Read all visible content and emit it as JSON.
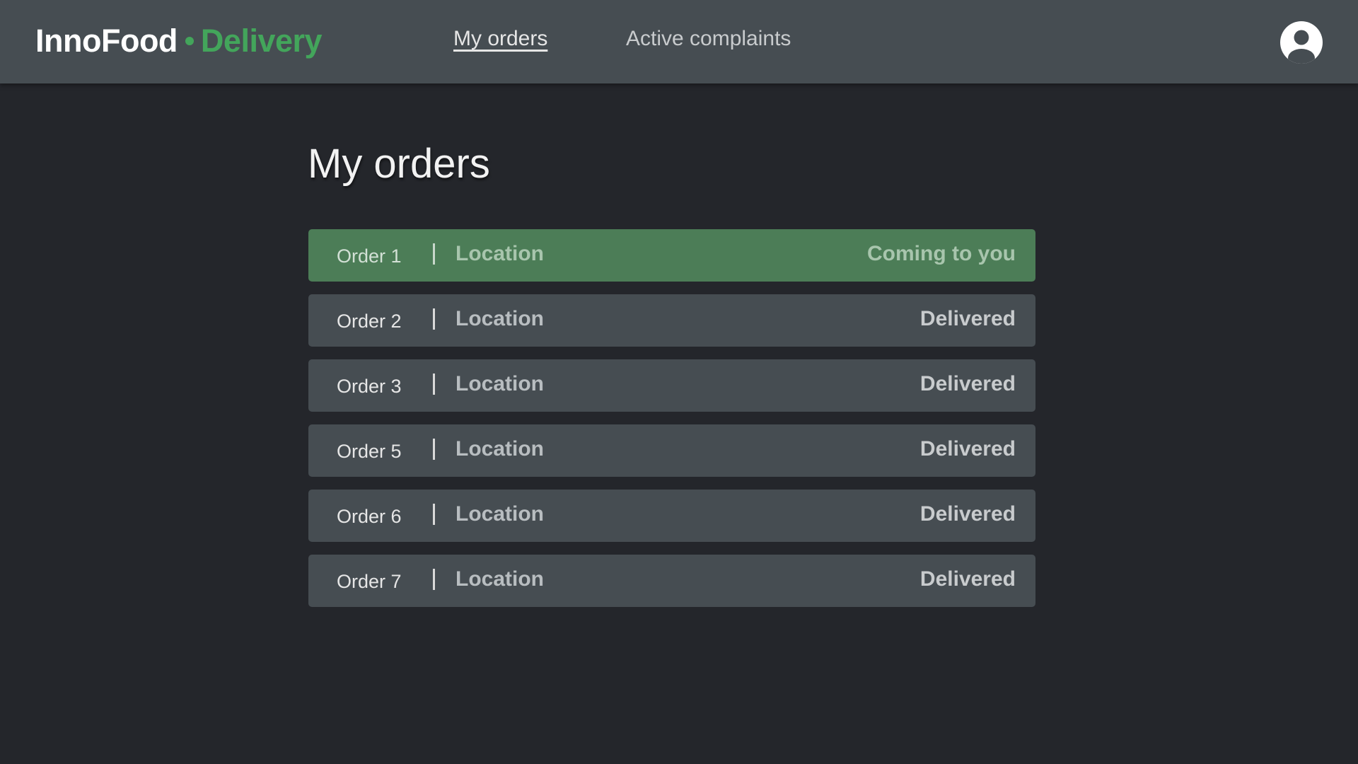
{
  "brand": {
    "name": "InnoFood",
    "sub": "Delivery",
    "accent_color": "#43a55b"
  },
  "nav": {
    "my_orders": "My orders",
    "active_complaints": "Active complaints"
  },
  "user": {
    "avatar_icon": "user-circle-icon"
  },
  "page": {
    "title": "My orders"
  },
  "orders": [
    {
      "name": "Order 1",
      "location": "Location",
      "status": "Coming to you",
      "active": true
    },
    {
      "name": "Order 2",
      "location": "Location",
      "status": "Delivered",
      "active": false
    },
    {
      "name": "Order 3",
      "location": "Location",
      "status": "Delivered",
      "active": false
    },
    {
      "name": "Order 5",
      "location": "Location",
      "status": "Delivered",
      "active": false
    },
    {
      "name": "Order 6",
      "location": "Location",
      "status": "Delivered",
      "active": false
    },
    {
      "name": "Order 7",
      "location": "Location",
      "status": "Delivered",
      "active": false
    }
  ],
  "colors": {
    "header_bg": "#464d52",
    "page_bg": "#24262b",
    "active_row": "#4c7d57",
    "row_bg": "#464d52"
  }
}
